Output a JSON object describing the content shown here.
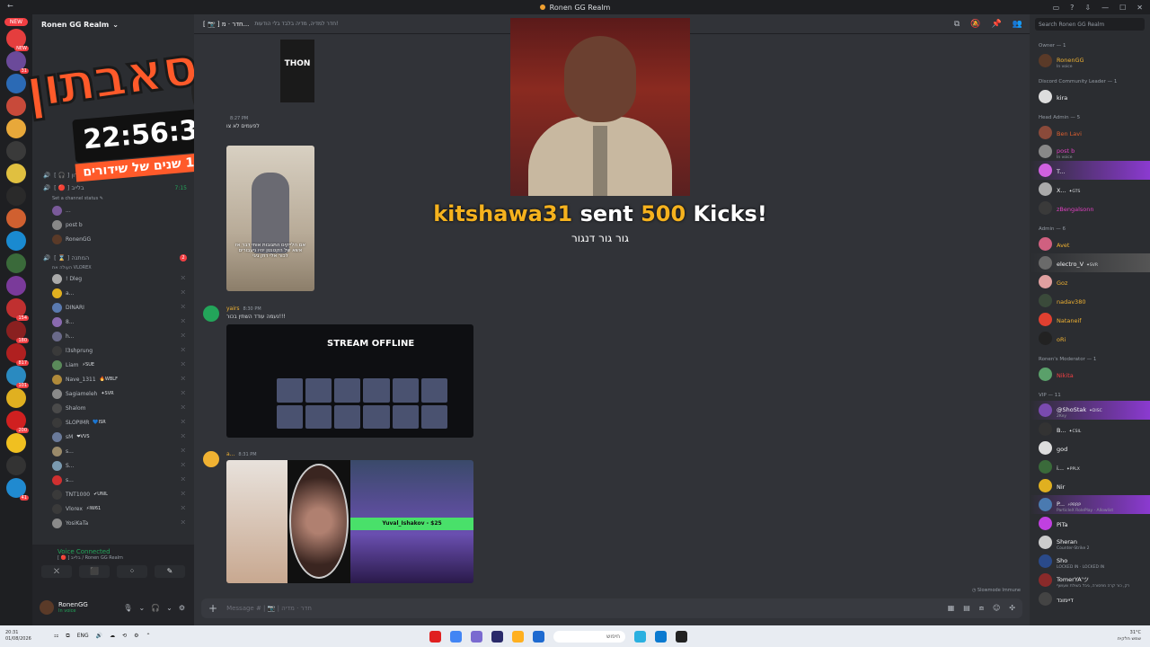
{
  "window": {
    "title": "Ronen GG Realm",
    "back": "←"
  },
  "server": {
    "name": "Ronen GG Realm",
    "chevron": "⌄"
  },
  "guilds": [
    {
      "color": "#e53e3e",
      "badge": "NEW"
    },
    {
      "color": "#6b4a9a",
      "badge": "31"
    },
    {
      "color": "#2b6ab5",
      "badge": ""
    },
    {
      "color": "#c84a3a",
      "badge": ""
    },
    {
      "color": "#e8a83a",
      "badge": ""
    },
    {
      "color": "#3a3a3a",
      "badge": ""
    },
    {
      "color": "#e0c040",
      "badge": ""
    },
    {
      "color": "#2a2a2a",
      "badge": ""
    },
    {
      "color": "#d06030",
      "badge": ""
    },
    {
      "color": "#1a8ad0",
      "badge": ""
    },
    {
      "color": "#3a6a3a",
      "badge": ""
    },
    {
      "color": "#7a3a9a",
      "badge": ""
    },
    {
      "color": "#c03030",
      "badge": "154"
    },
    {
      "color": "#8a2020",
      "badge": "180"
    },
    {
      "color": "#b02020",
      "badge": "817"
    },
    {
      "color": "#2a8ac0",
      "badge": "101"
    },
    {
      "color": "#e0b020",
      "badge": ""
    },
    {
      "color": "#d02020",
      "badge": "200"
    },
    {
      "color": "#f0c020",
      "badge": ""
    },
    {
      "color": "#333",
      "badge": ""
    },
    {
      "color": "#208ad0",
      "badge": "41"
    }
  ],
  "guild_new": "NEW",
  "channels": {
    "rows": [
      {
        "label": "[ 🎧 ] חברי מועדון",
        "num": "",
        "unread": ""
      },
      {
        "label": "[ 🔴 ] בלייב",
        "num": "7:15",
        "unread": ""
      }
    ],
    "set_status": "Set a channel status ✎",
    "live_users": [
      {
        "name": "...",
        "color": "#7a5a9a"
      },
      {
        "name": "post b",
        "color": "#888"
      },
      {
        "name": "RonenGG",
        "color": "#5a3a28"
      }
    ],
    "waiting": {
      "label": "[ ⌛ ] המתנה",
      "sub": "העולה את VLOREX",
      "unread": "2"
    },
    "waiting_users": [
      {
        "name": "! Dleg",
        "tag": "",
        "color": "#aaa"
      },
      {
        "name": "a...",
        "tag": "",
        "color": "#e0b020"
      },
      {
        "name": "DINARI",
        "tag": "",
        "color": "#5a7ab0"
      },
      {
        "name": "8...",
        "tag": "",
        "color": "#8a6ab0"
      },
      {
        "name": "h...",
        "tag": "",
        "color": "#6a6a8a"
      },
      {
        "name": "l3shprung",
        "tag": "",
        "color": "#3a3a3a"
      },
      {
        "name": "Liam",
        "tag": "⚡SUE",
        "color": "#5a8a5a"
      },
      {
        "name": "Nave_1311",
        "tag": "🔥WBLF",
        "color": "#b08a3a"
      },
      {
        "name": "Sagiameleh",
        "tag": "✦SVR",
        "color": "#8a8a8a"
      },
      {
        "name": "Shalom",
        "tag": "",
        "color": "#4a4a4a"
      },
      {
        "name": "SLOPIMR",
        "tag": "💙ISR",
        "color": "#3a3a3a"
      },
      {
        "name": "sM",
        "tag": "❤VVS",
        "color": "#6a7a9a"
      },
      {
        "name": "s...",
        "tag": "",
        "color": "#9a8a6a"
      },
      {
        "name": "S...",
        "tag": "",
        "color": "#7a9ab0"
      },
      {
        "name": "s...",
        "tag": "",
        "color": "#d03030"
      },
      {
        "name": "TNT1000",
        "tag": "✔UNIL",
        "color": "#3a3a3a"
      },
      {
        "name": "Vlorex",
        "tag": "⚡IW61",
        "color": "#3a3a3a"
      },
      {
        "name": "YosiKaTa",
        "tag": "",
        "color": "#8a8a8a"
      }
    ]
  },
  "voice": {
    "connected": "Voice Connected",
    "sub": "[ 🔴 ] בלייב / Ronen GG Realm",
    "buttons": [
      "⛌",
      "⬛",
      "⁘",
      "✎"
    ]
  },
  "self": {
    "name": "RonenGG",
    "status": "In voice",
    "icons": [
      "🎙",
      "⌄",
      "🎧",
      "⌄",
      "⚙"
    ]
  },
  "overlay": {
    "title": "סאבתון",
    "timer": "22:56:39",
    "sub": "חוגגים 10 שנים של שידורים"
  },
  "channel_header": {
    "name": "[ 📷 ] חדר · מ...",
    "topic": "חדר למדיה, מדיה בלבד בלי הודעות!",
    "icons": [
      "⧉",
      "🔕",
      "📌",
      "👥"
    ]
  },
  "messages": [
    {
      "author": "",
      "time": "8:27 PM",
      "text": "לפעמים לא צו"
    },
    {
      "author": "yairs",
      "time": "8:30 PM",
      "text": "נעמה עודד השתין בכור!!!"
    },
    {
      "author": "a...",
      "time": "8:31 PM",
      "text": ""
    }
  ],
  "media": {
    "img0_text": "THON",
    "img1_caption": "אם הלייקים התגובות אותי דבר אז אשא של הקטנטן יהיו ניעבורים לכור אלי רוק גיגי",
    "img2_text": "STREAM OFFLINE",
    "img3_dono": "Yuval_Ishakov - $25"
  },
  "alert": {
    "user": "kitshawa31",
    "word": "sent",
    "amount": "500",
    "unit": "Kicks!",
    "message": "גור גור דנגור"
  },
  "composer": {
    "placeholder": "Message # | 📷 | חדר · מדיה",
    "plus": "+",
    "icons": [
      "▦",
      "▤",
      "⧈",
      "☺",
      "✣"
    ]
  },
  "slowmode": "◷ Slowmode Immune",
  "members": {
    "search": "Search Ronen GG Realm",
    "groups": [
      {
        "role": "Owner — 1",
        "list": [
          {
            "name": "RonenGG",
            "sub": "In voice",
            "color": "#f0b232",
            "av": "#5a3a28",
            "tag": "",
            "hl": ""
          }
        ]
      },
      {
        "role": "Discord Community Leader — 1",
        "list": [
          {
            "name": "kira",
            "sub": "",
            "color": "#f2f3f5",
            "av": "#ddd",
            "tag": "",
            "hl": ""
          }
        ]
      },
      {
        "role": "Head Admin — 5",
        "list": [
          {
            "name": "Ben Lavi",
            "sub": "",
            "color": "#e06030",
            "av": "#8a4a3a",
            "tag": "",
            "hl": ""
          },
          {
            "name": "post b",
            "sub": "In voice",
            "color": "#e040c0",
            "av": "#888",
            "tag": "",
            "hl": ""
          },
          {
            "name": "T...",
            "sub": "",
            "color": "#f2f3f5",
            "av": "#d060e0",
            "tag": "",
            "hl": "hl"
          },
          {
            "name": "X...",
            "sub": "",
            "color": "#f2f3f5",
            "av": "#aaa",
            "tag": "✦GTS",
            "hl": ""
          },
          {
            "name": "zBengalsonn",
            "sub": "",
            "color": "#e040c0",
            "av": "#3a3a3a",
            "tag": "",
            "hl": ""
          }
        ]
      },
      {
        "role": "Admin — 6",
        "list": [
          {
            "name": "Avet",
            "sub": "",
            "color": "#f0b232",
            "av": "#d06080",
            "tag": "",
            "hl": ""
          },
          {
            "name": "electro_V",
            "sub": "",
            "color": "#f2f3f5",
            "av": "#6a6a6a",
            "tag": "✦SVR",
            "hl": "hl2"
          },
          {
            "name": "Goz",
            "sub": "",
            "color": "#f0b232",
            "av": "#e0a0a0",
            "tag": "",
            "hl": ""
          },
          {
            "name": "nadav380",
            "sub": "",
            "color": "#f0b232",
            "av": "#3a4a3a",
            "tag": "",
            "hl": ""
          },
          {
            "name": "Nataneif",
            "sub": "",
            "color": "#f0b232",
            "av": "#e04030",
            "tag": "",
            "hl": ""
          },
          {
            "name": "oRi",
            "sub": "",
            "color": "#f0b232",
            "av": "#222",
            "tag": "",
            "hl": ""
          }
        ]
      },
      {
        "role": "Ronen's Moderator — 1",
        "list": [
          {
            "name": "Nikita",
            "sub": "",
            "color": "#f23f43",
            "av": "#5aa06a",
            "tag": "",
            "hl": ""
          }
        ]
      },
      {
        "role": "VIP — 11",
        "list": [
          {
            "name": "@ShoStak",
            "sub": "2Key",
            "color": "#f2f3f5",
            "av": "#7a4ab0",
            "tag": "✦DISC",
            "hl": "hl"
          },
          {
            "name": "B...",
            "sub": "",
            "color": "#f2f3f5",
            "av": "#333",
            "tag": "✦CSIL",
            "hl": ""
          },
          {
            "name": "god",
            "sub": "",
            "color": "#f2f3f5",
            "av": "#ddd",
            "tag": "",
            "hl": ""
          },
          {
            "name": "i...",
            "sub": "",
            "color": "#f2f3f5",
            "av": "#3a6a3a",
            "tag": "✦PPLX",
            "hl": ""
          },
          {
            "name": "Nir",
            "sub": "",
            "color": "#f2f3f5",
            "av": "#e0b020",
            "tag": "",
            "hl": ""
          },
          {
            "name": "P...",
            "sub": "ParticleX RolePlay · Allowlist",
            "color": "#f2f3f5",
            "av": "#4a7ab0",
            "tag": "⚡PRRP",
            "hl": "hl"
          },
          {
            "name": "PiTa",
            "sub": "",
            "color": "#f2f3f5",
            "av": "#c040e0",
            "tag": "",
            "hl": ""
          },
          {
            "name": "Sheran",
            "sub": "Counter-Strike 2",
            "color": "#f2f3f5",
            "av": "#ccc",
            "tag": "",
            "hl": ""
          },
          {
            "name": "Sho",
            "sub": "LOCKED IN · LOCKED IN",
            "color": "#f2f3f5",
            "av": "#2a4a8a",
            "tag": "",
            "hl": ""
          },
          {
            "name": "TomerYA'ツ",
            "sub": "רק, כור קרה מפסורה, גיבל בשולת שעושף",
            "color": "#f2f3f5",
            "av": "#8a2a2a",
            "tag": "",
            "hl": ""
          },
          {
            "name": "דיימונד",
            "sub": "",
            "color": "#f2f3f5",
            "av": "#444",
            "tag": "",
            "hl": ""
          }
        ]
      }
    ]
  },
  "taskbar": {
    "time_left": "20:31",
    "date_left": "01/08/2026",
    "lang": "ENG",
    "search": "חיפוש",
    "temp": "31°C",
    "weather": "שמש חלקית",
    "tray": [
      "⚏",
      "⧉",
      "ENG",
      "🔊",
      "☁",
      "⟲",
      "⚙",
      "⌃"
    ],
    "apps": [
      "#e02020",
      "#4285f4",
      "#7a6ad0",
      "#2a2a6a",
      "#ffb020",
      "#1e6ad0",
      "#2ab0e0",
      "#0a7ad0",
      "#222"
    ]
  }
}
